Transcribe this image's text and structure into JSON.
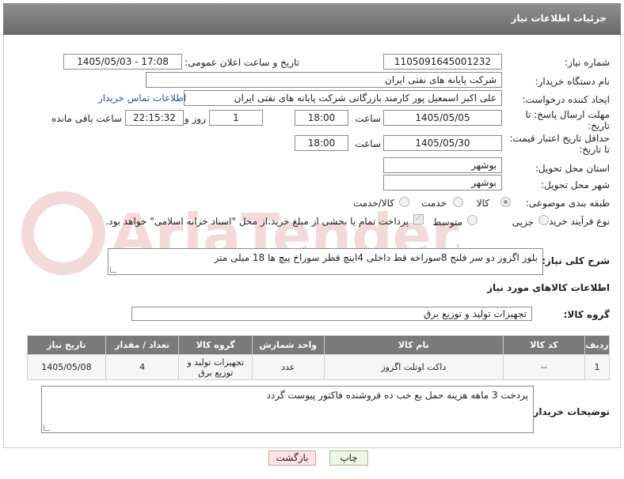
{
  "header": {
    "title": "جزئیات اطلاعات نیاز"
  },
  "form": {
    "need_number_label": "شماره نیاز:",
    "need_number": "1105091645001232",
    "announce_label": "تاریخ و ساعت اعلان عمومی:",
    "announce_value": "1405/05/03 - 17:08",
    "buyer_org_label": "نام دستگاه خریدار:",
    "buyer_org": "شرکت پایانه های نفتی ایران",
    "creator_label": "ایجاد کننده درخواست:",
    "creator": "علی اکبر اسمعیل پور کارمند بازرگانی شرکت پایانه های نفتی ایران",
    "contact_link": "اطلاعات تماس خریدار",
    "deadline_label_1": "مهلت ارسال پاسخ: تا",
    "deadline_label_2": "تاریخ:",
    "deadline_date": "1405/05/05",
    "time_label": "ساعت",
    "deadline_time": "18:00",
    "days_value": "1",
    "days_label": "روز و",
    "remaining_time": "22:15:32",
    "remaining_label": "ساعت باقی مانده",
    "price_label_1": "حداقل تاریخ اعتبار قیمت:",
    "price_label_2": "تا تاریخ:",
    "price_date": "1405/05/30",
    "price_time": "18:00",
    "province_label": "استان محل تحویل:",
    "province": "بوشهر",
    "city_label": "شهر محل تحویل:",
    "city": "بوشهر",
    "category_label": "طبقه بندی موضوعی:",
    "category_options": [
      "کالا",
      "خدمت",
      "کالا/خدمت"
    ],
    "category_selected": "کالا",
    "process_label": "نوع فرآیند خرید :",
    "process_options": [
      "جزیی",
      "متوسط"
    ],
    "payment_note": "پرداخت تمام یا بخشی از مبلغ خرید،از محل \"اسناد خزانه اسلامی\" خواهد بود."
  },
  "description": {
    "label": "شرح کلی نیاز:",
    "text": "بلوز اگزوز دو سر فلنج 8سوراخه قط داخلی 4اینچ قطر سوراخ پیچ ها 18 میلی متر"
  },
  "goods": {
    "section_title": "اطلاعات کالاهای مورد نیاز",
    "group_label": "گروه کالا:",
    "group_value": "تجهیزات تولید و توزیع برق",
    "columns": [
      "ردیف",
      "کد کالا",
      "نام کالا",
      "واحد شمارش",
      "گروه کالا",
      "تعداد / مقدار",
      "تاریخ نیاز"
    ],
    "rows": [
      {
        "row": "1",
        "code": "--",
        "name": "داکت اوتلت اگزوز",
        "unit": "عدد",
        "group": "تجهیزات تولید و توزیع برق",
        "qty": "4",
        "date": "1405/05/08"
      }
    ]
  },
  "buyer_notes": {
    "label": "توضیحات خریدار:",
    "text": "پردخت 3 ماهه هزینه حمل بع خب ده فروشنده فاکتور پیوست گردد"
  },
  "buttons": {
    "print": "چاپ",
    "back": "بازگشت"
  },
  "watermark_text": "AriaTender.net",
  "colors": {
    "header": "#7a7a7a",
    "link": "#1a5ea8",
    "watermark": "#c0392b"
  }
}
